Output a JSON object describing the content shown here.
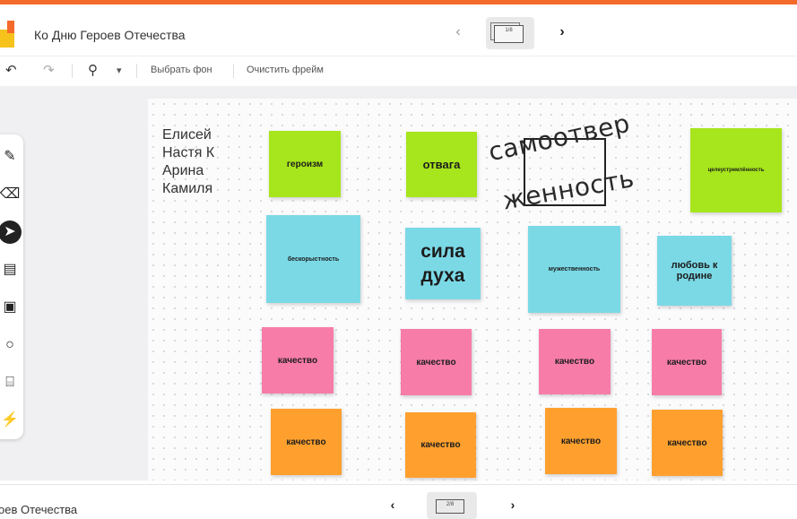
{
  "header": {
    "title": "Ко Дню Героев Отечества",
    "frame_indicator": "1/8"
  },
  "toolbar": {
    "choose_background": "Выбрать фон",
    "clear_frame": "Очистить фрейм",
    "zoom_caret": "▾"
  },
  "names": [
    "Елисей",
    "Настя К",
    "Арина",
    "Камиля"
  ],
  "stickies": {
    "r1": [
      "героизм",
      "отвага",
      "целеустремлённость"
    ],
    "r2": [
      "бескорыстность",
      "сила духа",
      "мужественность",
      "любовь к родине"
    ],
    "r3": [
      "качество",
      "качество",
      "качество",
      "качество"
    ],
    "r4": [
      "качество",
      "качество",
      "качество",
      "качество"
    ]
  },
  "handwritten": {
    "line1": "самоотвер",
    "line2": "женность"
  },
  "footer": {
    "title": "оев Отечества",
    "frame_indicator": "2/8"
  },
  "colors": {
    "accent": "#f46a2a",
    "green": "#a7e51c",
    "blue": "#7bd9e6",
    "pink": "#f77ca8",
    "orange": "#ffa02e"
  }
}
